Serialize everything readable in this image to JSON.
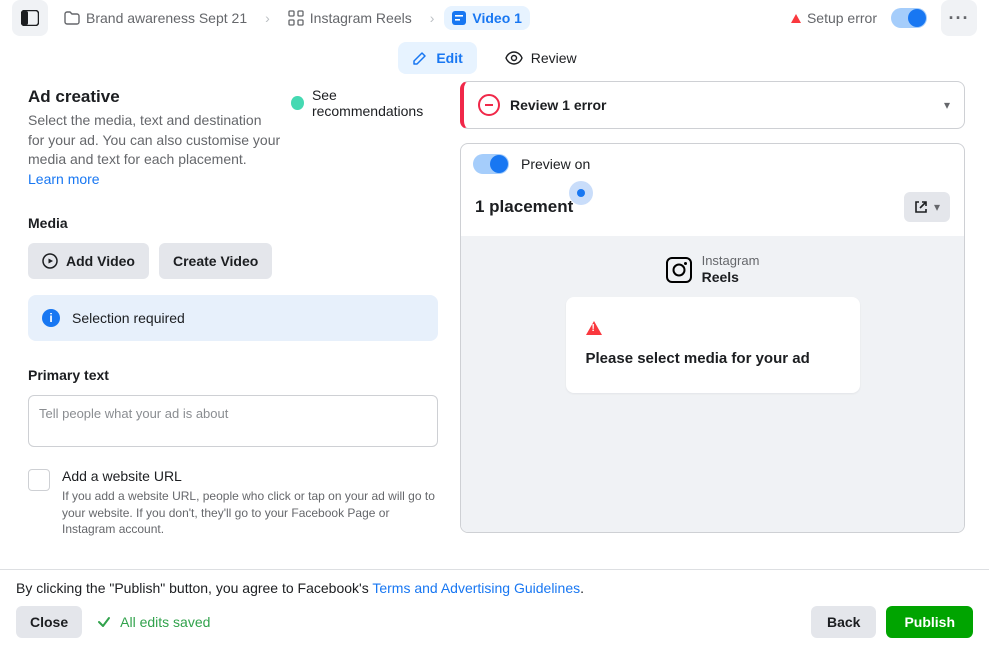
{
  "breadcrumb": {
    "campaign": "Brand awareness Sept 21",
    "adset": "Instagram Reels",
    "ad": "Video 1"
  },
  "header": {
    "status": "Setup error"
  },
  "tabs": {
    "edit": "Edit",
    "review": "Review"
  },
  "creative": {
    "title": "Ad creative",
    "reco": "See recommendations",
    "desc": "Select the media, text and destination for your ad. You can also customise your media and text for each placement. ",
    "learn": "Learn more",
    "media_label": "Media",
    "add_video": "Add Video",
    "create_video": "Create Video",
    "selection_required": "Selection required",
    "primary_text_label": "Primary text",
    "primary_text_placeholder": "Tell people what your ad is about",
    "add_url_label": "Add a website URL",
    "add_url_help": "If you add a website URL, people who click or tap on your ad will go to your website. If you don't, they'll go to your Facebook Page or Instagram account."
  },
  "right": {
    "error_banner": "Review 1 error",
    "preview_on": "Preview on",
    "placement_count": "1 placement",
    "placement_network": "Instagram",
    "placement_type": "Reels",
    "media_missing": "Please select media for your ad"
  },
  "footer": {
    "note_pre": "By clicking the \"Publish\" button, you agree to Facebook's ",
    "note_link": "Terms and Advertising Guidelines",
    "close": "Close",
    "saved": "All edits saved",
    "back": "Back",
    "publish": "Publish"
  }
}
